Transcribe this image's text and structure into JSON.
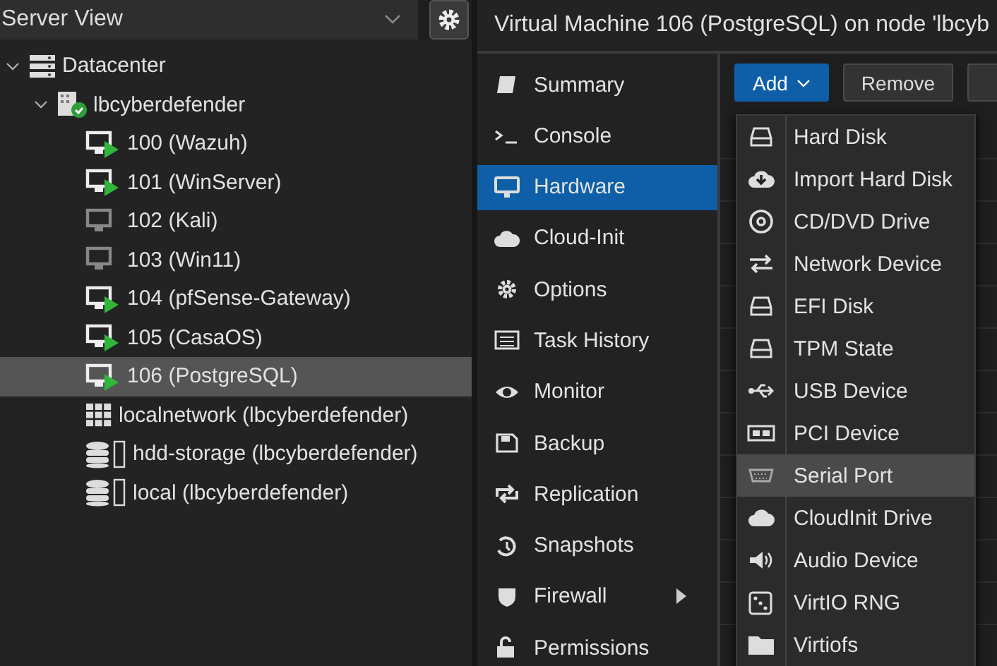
{
  "view_selector": {
    "value": "Server View"
  },
  "tree": [
    {
      "kind": "datacenter",
      "label": "Datacenter",
      "expanded": true,
      "selected": false,
      "children": [
        {
          "kind": "node",
          "label": "lbcyberdefender",
          "expanded": true,
          "selected": false,
          "children": [
            {
              "kind": "vm",
              "label": "100 (Wazuh)",
              "running": true,
              "selected": false
            },
            {
              "kind": "vm",
              "label": "101 (WinServer)",
              "running": true,
              "selected": false
            },
            {
              "kind": "vm",
              "label": "102 (Kali)",
              "running": false,
              "selected": false
            },
            {
              "kind": "vm",
              "label": "103 (Win11)",
              "running": false,
              "selected": false
            },
            {
              "kind": "vm",
              "label": "104 (pfSense-Gateway)",
              "running": true,
              "selected": false
            },
            {
              "kind": "vm",
              "label": "105 (CasaOS)",
              "running": true,
              "selected": false
            },
            {
              "kind": "vm",
              "label": "106 (PostgreSQL)",
              "running": true,
              "selected": true
            },
            {
              "kind": "network",
              "label": "localnetwork (lbcyberdefender)",
              "selected": false
            },
            {
              "kind": "storage",
              "label": "hdd-storage (lbcyberdefender)",
              "selected": false
            },
            {
              "kind": "storage",
              "label": "local (lbcyberdefender)",
              "selected": false
            }
          ]
        }
      ]
    }
  ],
  "panel_title": "Virtual Machine 106 (PostgreSQL) on node 'lbcyb",
  "nav": [
    {
      "label": "Summary",
      "selected": false
    },
    {
      "label": "Console",
      "selected": false
    },
    {
      "label": "Hardware",
      "selected": true
    },
    {
      "label": "Cloud-Init",
      "selected": false
    },
    {
      "label": "Options",
      "selected": false
    },
    {
      "label": "Task History",
      "selected": false
    },
    {
      "label": "Monitor",
      "selected": false
    },
    {
      "label": "Backup",
      "selected": false
    },
    {
      "label": "Replication",
      "selected": false
    },
    {
      "label": "Snapshots",
      "selected": false
    },
    {
      "label": "Firewall",
      "selected": false,
      "has_submenu": true
    },
    {
      "label": "Permissions",
      "selected": false
    }
  ],
  "toolbar": [
    {
      "label": "Add",
      "kind": "dropdown"
    },
    {
      "label": "Remove",
      "kind": "plain"
    }
  ],
  "add_menu": [
    {
      "label": "Hard Disk",
      "highlighted": false
    },
    {
      "label": "Import Hard Disk",
      "highlighted": false
    },
    {
      "label": "CD/DVD Drive",
      "highlighted": false
    },
    {
      "label": "Network Device",
      "highlighted": false
    },
    {
      "label": "EFI Disk",
      "highlighted": false
    },
    {
      "label": "TPM State",
      "highlighted": false
    },
    {
      "label": "USB Device",
      "highlighted": false
    },
    {
      "label": "PCI Device",
      "highlighted": false
    },
    {
      "label": "Serial Port",
      "highlighted": true
    },
    {
      "label": "CloudInit Drive",
      "highlighted": false
    },
    {
      "label": "Audio Device",
      "highlighted": false
    },
    {
      "label": "VirtIO RNG",
      "highlighted": false
    },
    {
      "label": "Virtiofs",
      "highlighted": false
    }
  ]
}
